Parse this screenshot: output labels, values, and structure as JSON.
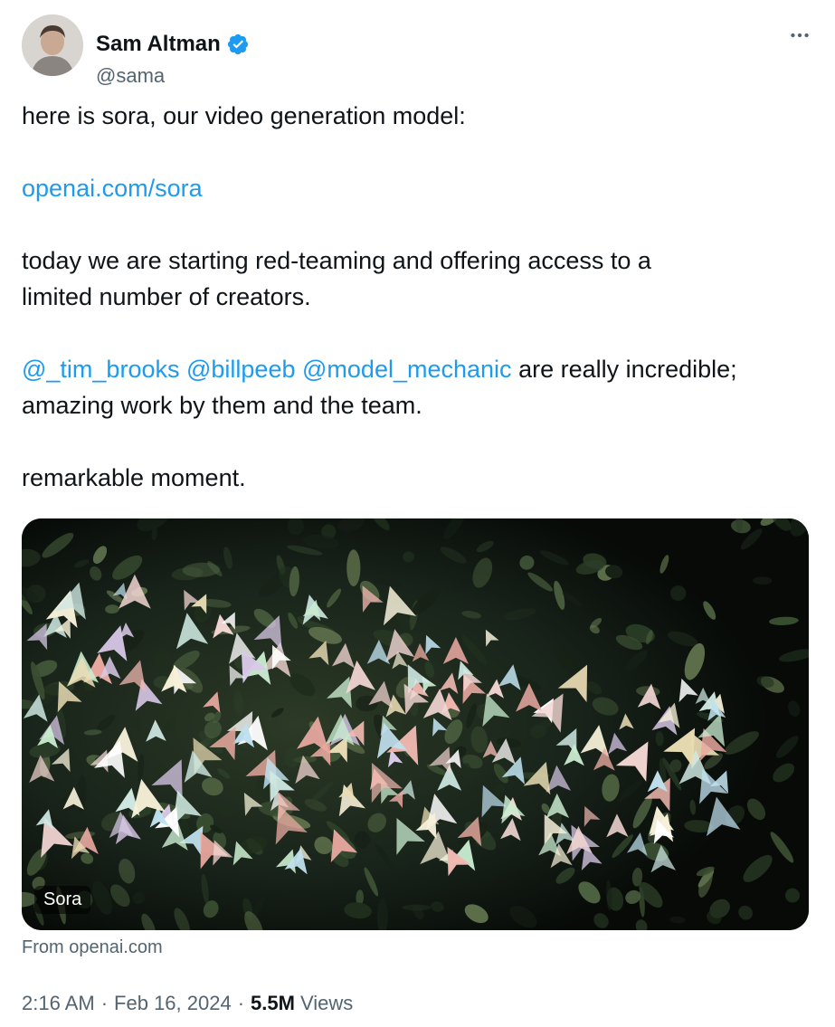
{
  "author": {
    "name": "Sam Altman",
    "handle": "@sama",
    "verified": true
  },
  "more_icon": "more-horizontal-icon",
  "tweet": {
    "line1": "here is sora, our video generation model:",
    "link": "openai.com/sora",
    "line3a": "today we are starting red-teaming and offering access to a",
    "line3b": "limited number of creators.",
    "mention1": "@_tim_brooks",
    "mention2": "@billpeeb",
    "mention3": "@model_mechanic",
    "line4_tail": "are really incredible;",
    "line4b": "amazing work by them and the team.",
    "line5": "remarkable moment."
  },
  "media": {
    "label": "Sora",
    "description_icon": "video-thumbnail"
  },
  "source": "From openai.com",
  "meta": {
    "time": "2:16 AM",
    "separator": "·",
    "date": "Feb 16, 2024",
    "views_count": "5.5M",
    "views_label": "Views"
  },
  "colors": {
    "link": "#1d9bf0",
    "secondary_text": "#536471",
    "verified_badge": "#1d9bf0"
  }
}
